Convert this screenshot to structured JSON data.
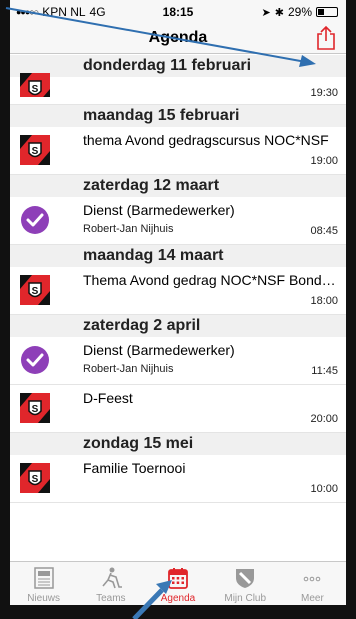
{
  "status": {
    "carrier": "KPN NL",
    "network": "4G",
    "time": "18:15",
    "battery": "29%",
    "battery_level": 0.29
  },
  "navbar": {
    "title": "Agenda"
  },
  "sections": [
    {
      "header": "donderdag 11 februari",
      "items": [
        {
          "title": "",
          "subtitle": "",
          "time": "19:30",
          "icon": "club-logo-icon"
        }
      ]
    },
    {
      "header": "maandag 15 februari",
      "items": [
        {
          "title": "thema Avond gedragscursus  NOC*NSF",
          "subtitle": "",
          "time": "19:00",
          "icon": "club-logo-icon"
        }
      ]
    },
    {
      "header": "zaterdag 12 maart",
      "items": [
        {
          "title": "Dienst (Barmedewerker)",
          "subtitle": "Robert-Jan Nijhuis",
          "time": "08:45",
          "icon": "checkmark-icon"
        }
      ]
    },
    {
      "header": "maandag 14 maart",
      "items": [
        {
          "title": "Thema Avond gedrag NOC*NSF Bondsbureau",
          "subtitle": "",
          "time": "18:00",
          "icon": "club-logo-icon"
        }
      ]
    },
    {
      "header": "zaterdag 2 april",
      "items": [
        {
          "title": "Dienst (Barmedewerker)",
          "subtitle": "Robert-Jan Nijhuis",
          "time": "11:45",
          "icon": "checkmark-icon"
        },
        {
          "title": "D-Feest",
          "subtitle": "",
          "time": "20:00",
          "icon": "club-logo-icon"
        }
      ]
    },
    {
      "header": "zondag 15 mei",
      "items": [
        {
          "title": "Familie Toernooi",
          "subtitle": "",
          "time": "10:00",
          "icon": "club-logo-icon"
        }
      ]
    }
  ],
  "tabs": [
    {
      "label": "Nieuws",
      "icon": "news-icon"
    },
    {
      "label": "Teams",
      "icon": "hockey-player-icon"
    },
    {
      "label": "Agenda",
      "icon": "calendar-icon",
      "active": true
    },
    {
      "label": "Mijn Club",
      "icon": "club-shield-icon"
    },
    {
      "label": "Meer",
      "icon": "more-dots-icon"
    }
  ],
  "colors": {
    "accent": "#e0262b",
    "check": "#8e3fb8",
    "annotation_arrow": "#2f6fb0"
  }
}
